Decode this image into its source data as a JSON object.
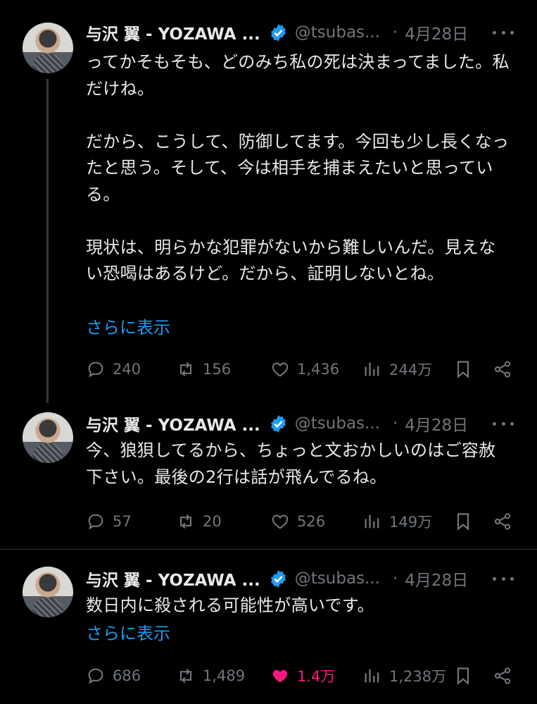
{
  "tweets": [
    {
      "author": "与沢 翼 - YOZAWA ...",
      "handle": "@tsubas...",
      "dot": "·",
      "date": "4月28日",
      "paragraphs": [
        "ってかそもそも、どのみち私の死は決まってました。私だけね。",
        "だから、こうして、防御してます。今回も少し長くなったと思う。そして、今は相手を捕まえたいと思っている。",
        "現状は、明らかな犯罪がないから難しいんだ。見えない恐喝はあるけど。だから、証明しないとね。"
      ],
      "show_more": "さらに表示",
      "replies": "240",
      "reposts": "156",
      "likes": "1,436",
      "views": "244万",
      "liked": false
    },
    {
      "author": "与沢 翼 - YOZAWA ...",
      "handle": "@tsubas...",
      "dot": "·",
      "date": "4月28日",
      "paragraphs": [
        "今、狼狽してるから、ちょっと文おかしいのはご容赦下さい。最後の2行は話が飛んでるね。"
      ],
      "replies": "57",
      "reposts": "20",
      "likes": "526",
      "views": "149万",
      "liked": false
    },
    {
      "author": "与沢 翼 - YOZAWA ...",
      "handle": "@tsubas...",
      "dot": "·",
      "date": "4月28日",
      "paragraphs": [
        "数日内に殺される可能性が高いです。"
      ],
      "show_more": "さらに表示",
      "replies": "686",
      "reposts": "1,489",
      "likes": "1.4万",
      "views": "1,238万",
      "liked": true
    }
  ],
  "colors": {
    "background": "#000000",
    "text": "#e7e9ea",
    "muted": "#71767b",
    "link": "#1d9bf0",
    "verified": "#1d9bf0",
    "like_active": "#f91880",
    "divider": "#2f3336"
  },
  "icons": [
    "reply-icon",
    "repost-icon",
    "like-icon",
    "views-icon",
    "bookmark-icon",
    "share-icon",
    "verified-badge-icon",
    "more-icon"
  ]
}
